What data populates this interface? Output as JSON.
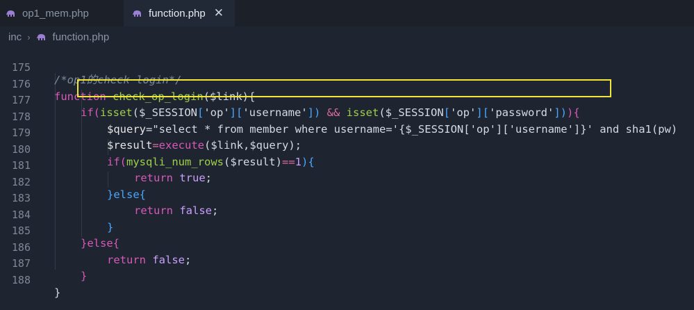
{
  "tabs": [
    {
      "label": "op1_mem.php",
      "icon": "php-elephant-icon",
      "active": false
    },
    {
      "label": "function.php",
      "icon": "php-elephant-icon",
      "active": true,
      "close": "✕"
    }
  ],
  "breadcrumb": {
    "folder": "inc",
    "separator": "›",
    "file": "function.php"
  },
  "lines": [
    {
      "num": "175"
    },
    {
      "num": "176"
    },
    {
      "num": "177"
    },
    {
      "num": "178"
    },
    {
      "num": "179"
    },
    {
      "num": "180"
    },
    {
      "num": "181"
    },
    {
      "num": "182"
    },
    {
      "num": "183"
    },
    {
      "num": "184"
    },
    {
      "num": "185"
    },
    {
      "num": "186"
    },
    {
      "num": "187"
    },
    {
      "num": "188"
    }
  ],
  "code": {
    "l175": "/*op1的check login*/",
    "l176_kw": "function",
    "l176_fn": "check_op_login",
    "l176_rest": "($link){",
    "l177_a": "if(",
    "l177_b": "isset",
    "l177_c": "($_SESSION",
    "l177_d": "[",
    "l177_e": "'op'",
    "l177_f": "][",
    "l177_g": "'username'",
    "l177_h": "])",
    "l177_i": " && ",
    "l177_j": "isset",
    "l177_k": "($_SESSION",
    "l177_l": "[",
    "l177_m": "'op'",
    "l177_n": "][",
    "l177_o": "'password'",
    "l177_p": "])",
    "l177_q": "){",
    "l178_var": "$query",
    "l178_rest": "=\"select * from member where username='{$_SESSION['op']['username']}' and sha1(pw)",
    "l179_var": "$result",
    "l179_eq": "=",
    "l179_fn": "execute",
    "l179_rest": "($link,$query);",
    "l180_kw": "if(",
    "l180_fn": "mysqli_num_rows",
    "l180_rest": "($result)",
    "l180_op": "==",
    "l180_num": "1",
    "l180_end": "){",
    "l181_kw": "return",
    "l181_val": " true",
    "l181_end": ";",
    "l182": "}else{",
    "l183_kw": "return",
    "l183_val": " false",
    "l183_end": ";",
    "l184": "}",
    "l185": "}else{",
    "l186_kw": "return",
    "l186_val": " false",
    "l186_end": ";",
    "l187": "}",
    "l188": "}"
  },
  "colors": {
    "highlight_box": "#f2e63a",
    "keyword": "#d85ab8",
    "function": "#9fd04a",
    "bracket": "#4aa8ff"
  }
}
